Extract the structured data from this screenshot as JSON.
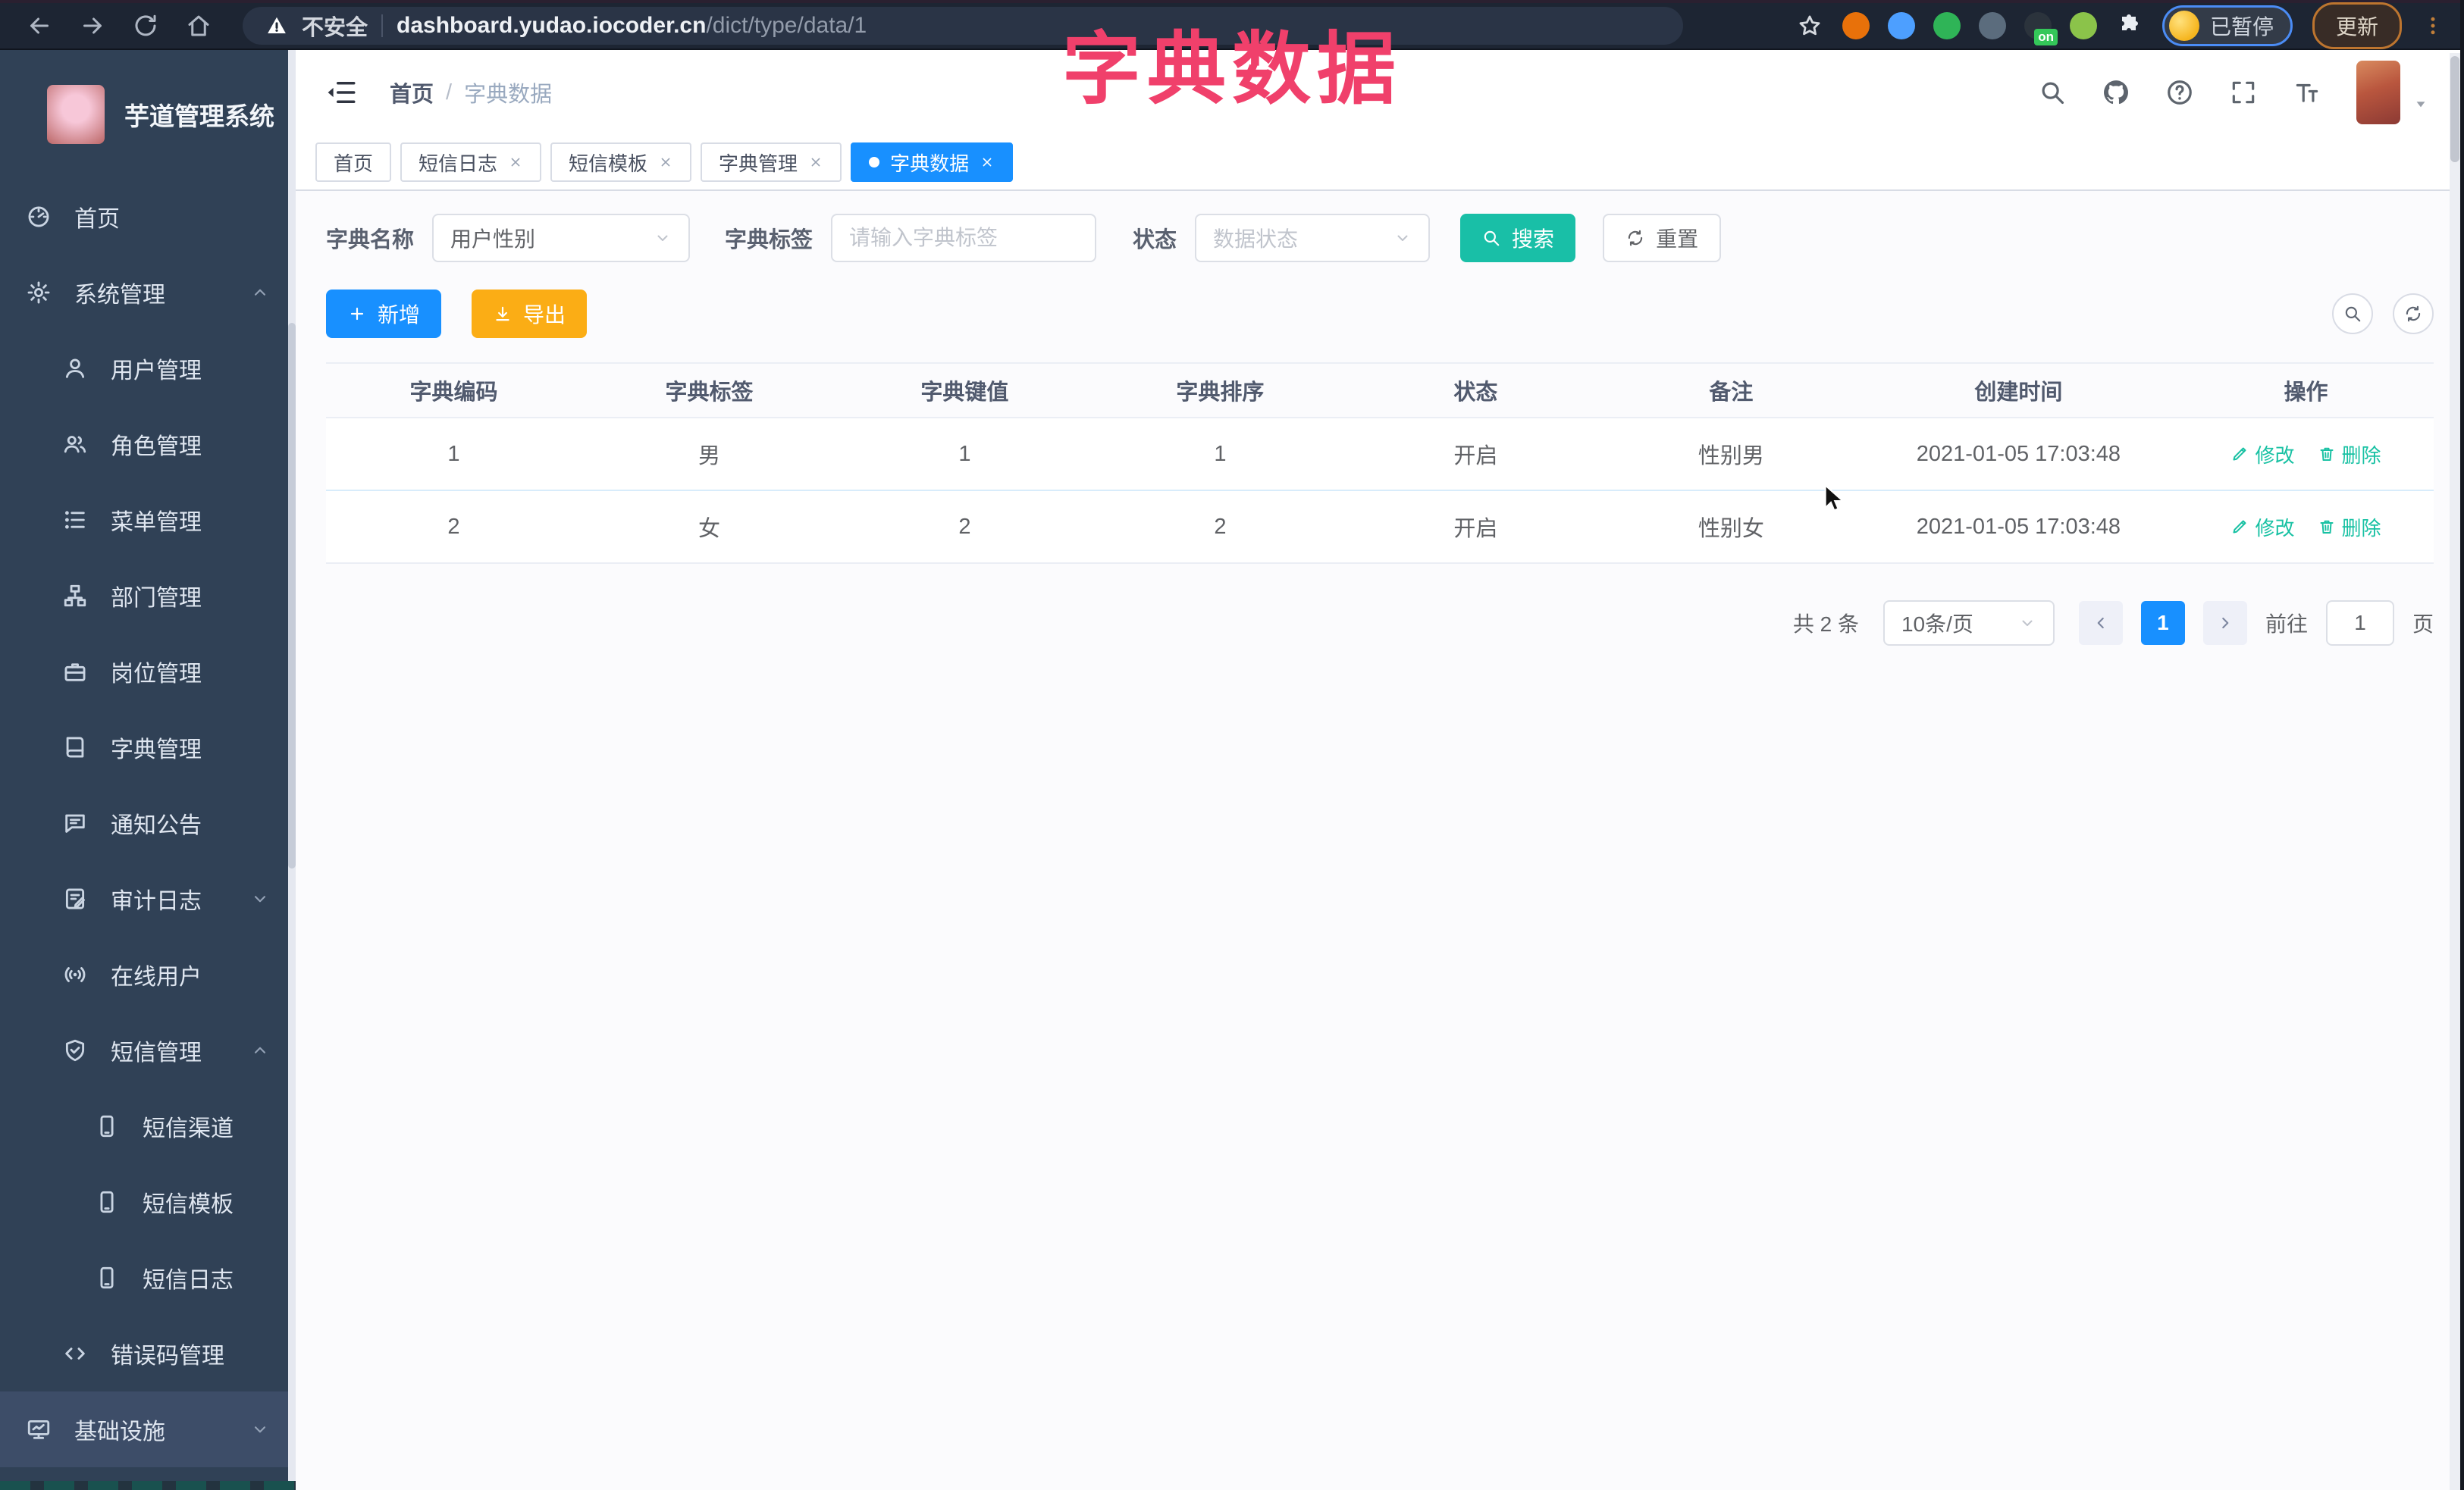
{
  "browser": {
    "security_label": "不安全",
    "url_domain": "dashboard.yudao.iocoder.cn",
    "url_path": "/dict/type/data/1",
    "profile_status": "已暂停",
    "update_label": "更新",
    "extension_icons": [
      {
        "name": "ext-orange-icon",
        "color": "#e8710a"
      },
      {
        "name": "ext-location-icon",
        "color": "#4d9fff"
      },
      {
        "name": "ext-check-green-icon",
        "color": "#2fb457"
      },
      {
        "name": "ext-stats-icon",
        "color": "#5b6c7d"
      },
      {
        "name": "ext-dark-on-icon",
        "color": "#2b333c",
        "badge": "on"
      },
      {
        "name": "ext-green-icon",
        "color": "#8bc34a"
      },
      {
        "name": "extensions-puzzle-icon",
        "color": "#e9edf2"
      }
    ]
  },
  "overlay_title": "字典数据",
  "sidebar": {
    "logo_title": "芋道管理系统",
    "items": [
      {
        "label": "首页",
        "icon": "dashboard-icon",
        "glyph": "dashboard",
        "level": 0
      },
      {
        "label": "系统管理",
        "icon": "gear-icon",
        "glyph": "gear",
        "level": 0,
        "chevron": "up"
      },
      {
        "label": "用户管理",
        "icon": "user-icon",
        "glyph": "user",
        "level": 1
      },
      {
        "label": "角色管理",
        "icon": "users-icon",
        "glyph": "users",
        "level": 1
      },
      {
        "label": "菜单管理",
        "icon": "menu-list-icon",
        "glyph": "menu-list",
        "level": 1
      },
      {
        "label": "部门管理",
        "icon": "org-tree-icon",
        "glyph": "org-tree",
        "level": 1
      },
      {
        "label": "岗位管理",
        "icon": "briefcase-icon",
        "glyph": "briefcase",
        "level": 1
      },
      {
        "label": "字典管理",
        "icon": "book-icon",
        "glyph": "book",
        "level": 1
      },
      {
        "label": "通知公告",
        "icon": "announcement-icon",
        "glyph": "announcement",
        "level": 1
      },
      {
        "label": "审计日志",
        "icon": "audit-log-icon",
        "glyph": "audit",
        "level": 1,
        "chevron": "down"
      },
      {
        "label": "在线用户",
        "icon": "online-users-icon",
        "glyph": "online",
        "level": 1
      },
      {
        "label": "短信管理",
        "icon": "sms-shield-icon",
        "glyph": "shield",
        "level": 1,
        "chevron": "up"
      },
      {
        "label": "短信渠道",
        "icon": "phone-icon",
        "glyph": "phone",
        "level": 2
      },
      {
        "label": "短信模板",
        "icon": "phone-icon",
        "glyph": "phone",
        "level": 2
      },
      {
        "label": "短信日志",
        "icon": "phone-icon",
        "glyph": "phone",
        "level": 2
      },
      {
        "label": "错误码管理",
        "icon": "code-icon",
        "glyph": "code",
        "level": 1
      },
      {
        "label": "基础设施",
        "icon": "monitor-icon",
        "glyph": "monitor",
        "level": 0,
        "chevron": "down",
        "highlight": true
      }
    ]
  },
  "header": {
    "breadcrumb_home": "首页",
    "breadcrumb_sep": "/",
    "breadcrumb_current": "字典数据",
    "icons": [
      {
        "name": "search-icon",
        "glyph": "search"
      },
      {
        "name": "github-icon",
        "glyph": "github"
      },
      {
        "name": "help-icon",
        "glyph": "help"
      },
      {
        "name": "fullscreen-icon",
        "glyph": "fullscreen"
      },
      {
        "name": "font-size-icon",
        "glyph": "font-size"
      }
    ]
  },
  "tabs": [
    {
      "label": "首页",
      "closable": false,
      "active": false
    },
    {
      "label": "短信日志",
      "closable": true,
      "active": false
    },
    {
      "label": "短信模板",
      "closable": true,
      "active": false
    },
    {
      "label": "字典管理",
      "closable": true,
      "active": false
    },
    {
      "label": "字典数据",
      "closable": true,
      "active": true
    }
  ],
  "filters": {
    "dict_name_label": "字典名称",
    "dict_name_value": "用户性别",
    "dict_label_label": "字典标签",
    "dict_label_placeholder": "请输入字典标签",
    "status_label": "状态",
    "status_placeholder": "数据状态",
    "search_label": "搜索",
    "reset_label": "重置"
  },
  "toolbar": {
    "add_label": "新增",
    "export_label": "导出"
  },
  "table": {
    "headers": [
      "字典编码",
      "字典标签",
      "字典键值",
      "字典排序",
      "状态",
      "备注",
      "创建时间",
      "操作"
    ],
    "rows": [
      {
        "code": "1",
        "label": "男",
        "value": "1",
        "sort": "1",
        "status": "开启",
        "remark": "性别男",
        "created": "2021-01-05 17:03:48"
      },
      {
        "code": "2",
        "label": "女",
        "value": "2",
        "sort": "2",
        "status": "开启",
        "remark": "性别女",
        "created": "2021-01-05 17:03:48"
      }
    ],
    "edit_label": "修改",
    "delete_label": "删除"
  },
  "pagination": {
    "total_text": "共 2 条",
    "page_size": "10条/页",
    "current_page": "1",
    "goto_label": "前往",
    "goto_value": "1",
    "page_unit": "页"
  },
  "colors": {
    "accent_blue": "#1890ff",
    "teal": "#19bfa7",
    "amber": "#fbad15",
    "link_teal": "#18c1a3",
    "overlay_pink": "#f0406b",
    "sidebar_bg": "#304156",
    "chrome_bg": "#1d2533"
  }
}
